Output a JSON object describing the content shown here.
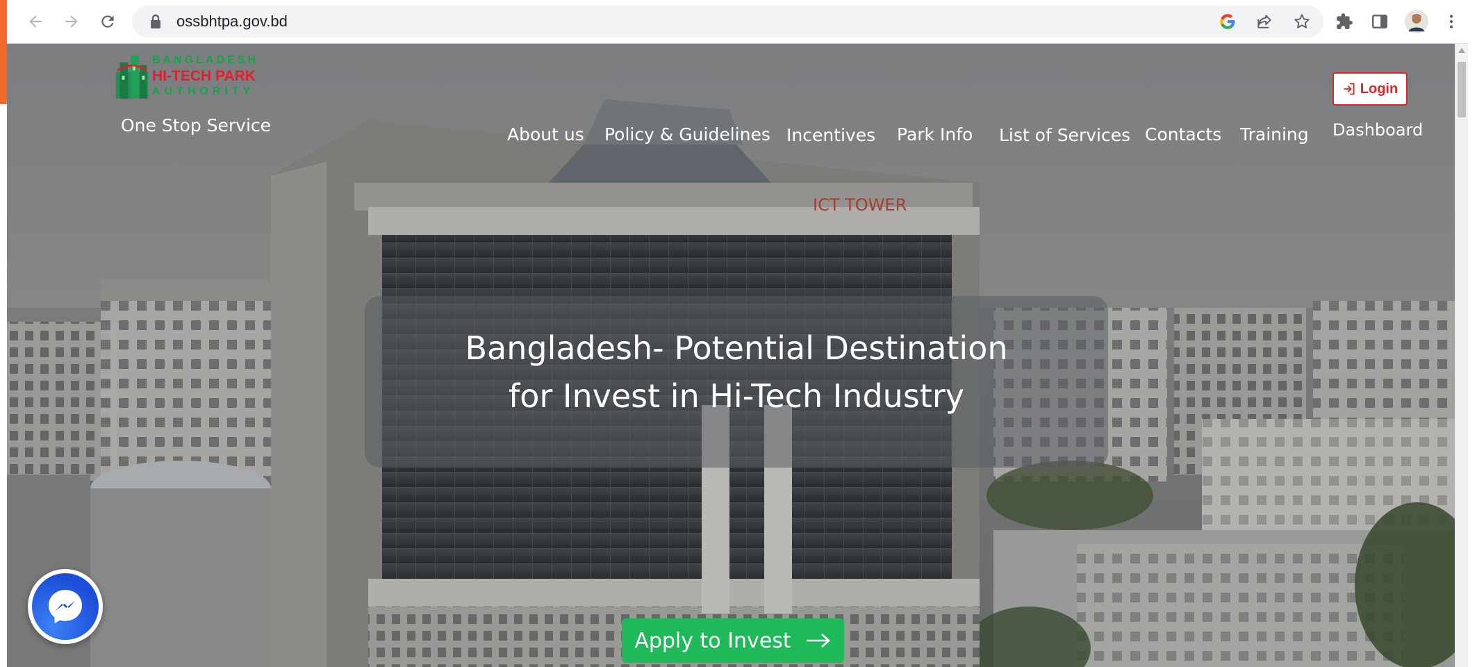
{
  "browser": {
    "url": "ossbhtpa.gov.bd"
  },
  "site": {
    "logo": {
      "line1": "BANGLADESH",
      "line2": "HI-TECH PARK",
      "line3": "AUTHORITY"
    },
    "tagline": "One Stop Service",
    "nav": [
      "About us",
      "Policy & Guidelines",
      "Incentives",
      "Park Info",
      "List of Services",
      "Contacts",
      "Training"
    ],
    "login_label": "Login",
    "dashboard_label": "Dashboard"
  },
  "hero": {
    "title_line1": "Bangladesh- Potential Destination",
    "title_line2": "for Invest in Hi-Tech Industry",
    "cta_label": "Apply to Invest"
  },
  "colors": {
    "accent_green": "#1fb95a",
    "login_red": "#dc2626",
    "messenger_blue": "#1d4ed8"
  },
  "icons": [
    "back-icon",
    "forward-icon",
    "reload-icon",
    "lock-icon",
    "google-icon",
    "share-icon",
    "star-icon",
    "extensions-icon",
    "side-panel-icon",
    "profile-avatar",
    "menu-dots-icon",
    "login-icon",
    "arrow-right-icon",
    "messenger-icon"
  ]
}
